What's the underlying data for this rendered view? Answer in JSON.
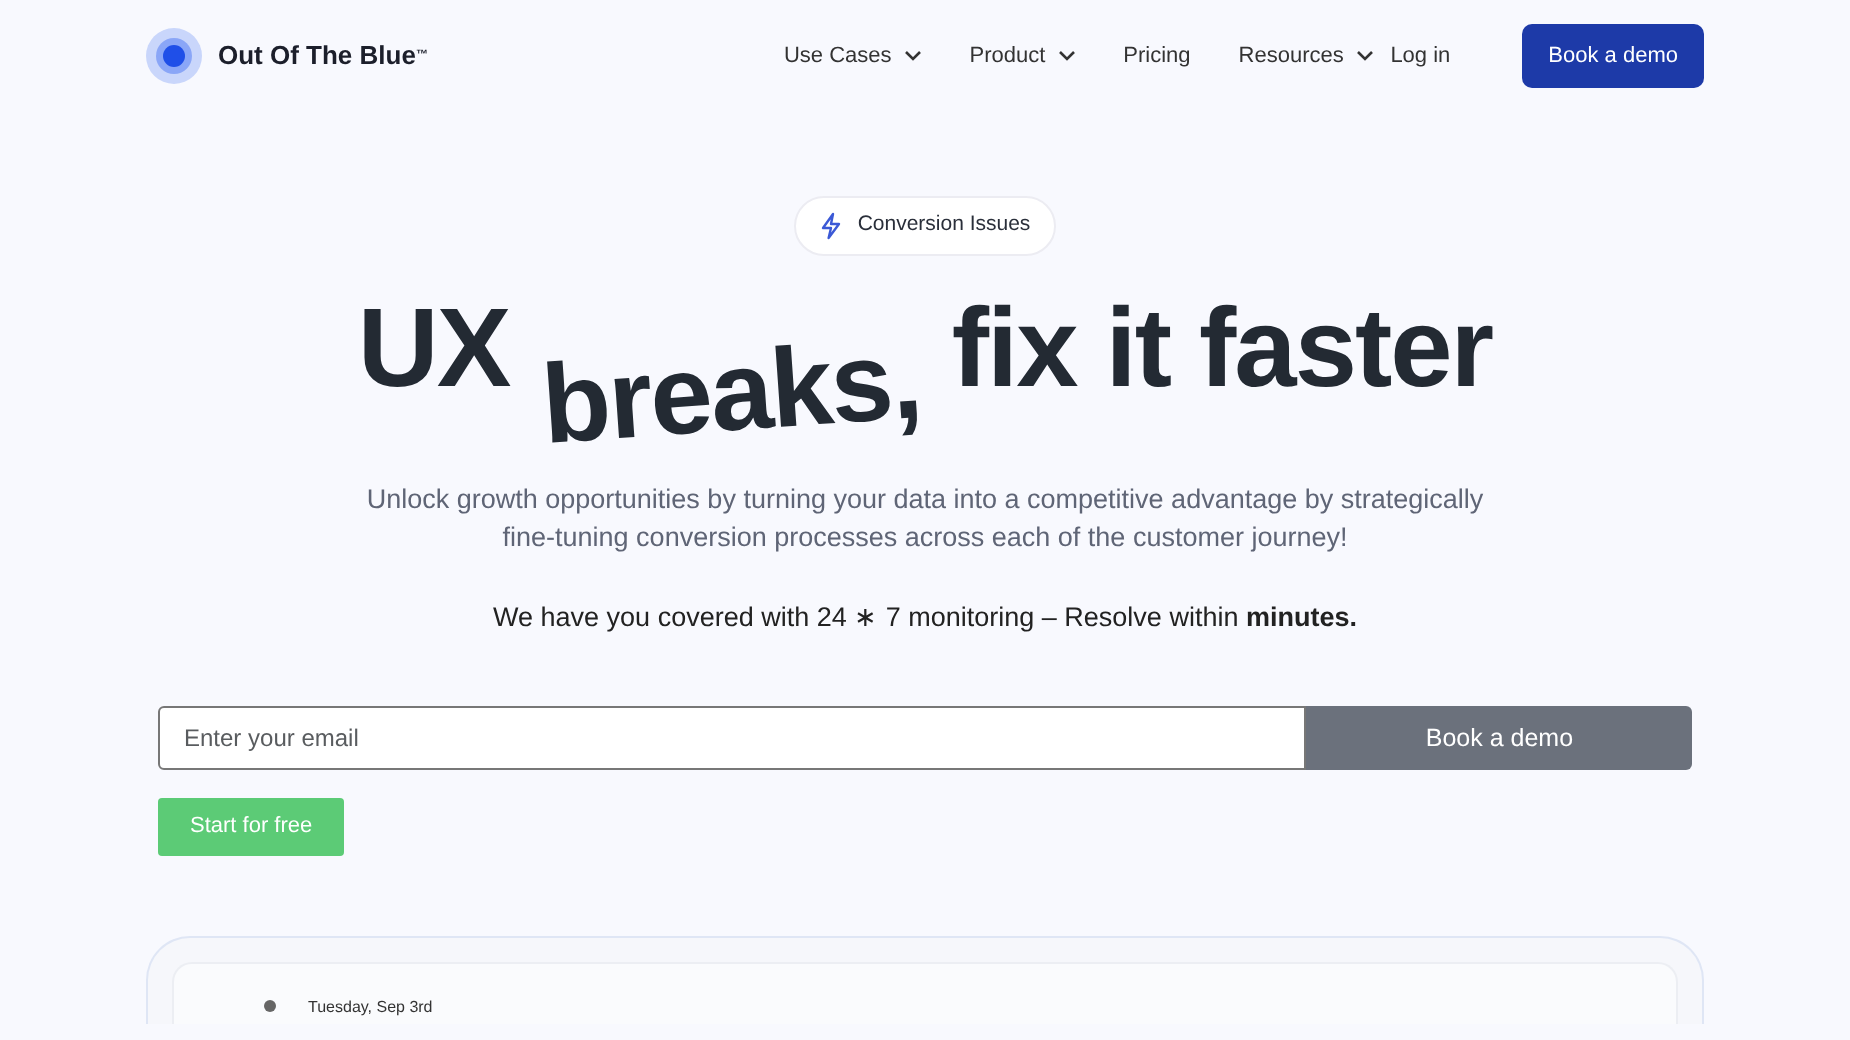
{
  "brand": {
    "name": "Out Of The Blue",
    "mark": "™"
  },
  "nav": [
    {
      "label": "Use Cases",
      "has_menu": true
    },
    {
      "label": "Product",
      "has_menu": true
    },
    {
      "label": "Pricing",
      "has_menu": false
    },
    {
      "label": "Resources",
      "has_menu": true
    }
  ],
  "login": "Log in",
  "header_cta": "Book a demo",
  "badge": "Conversion Issues",
  "headline": [
    {
      "text": "UX",
      "kind": "plain"
    },
    {
      "text": "breaks,",
      "kind": "dropped"
    },
    {
      "text": "fix it faster",
      "kind": "plain"
    }
  ],
  "intro": "Unlock growth opportunities by turning your data into a competitive advantage by strategically fine-tuning conversion processes across each of the customer journey!",
  "promise": "We have you covered with 24 ∗ 7 monitoring – Resolve within **minutes.**",
  "email": {
    "placeholder": "Enter your email"
  },
  "form_cta": "Book a demo",
  "start": "Start for free",
  "preview": {
    "date": "Tuesday, Sep 3rd"
  }
}
